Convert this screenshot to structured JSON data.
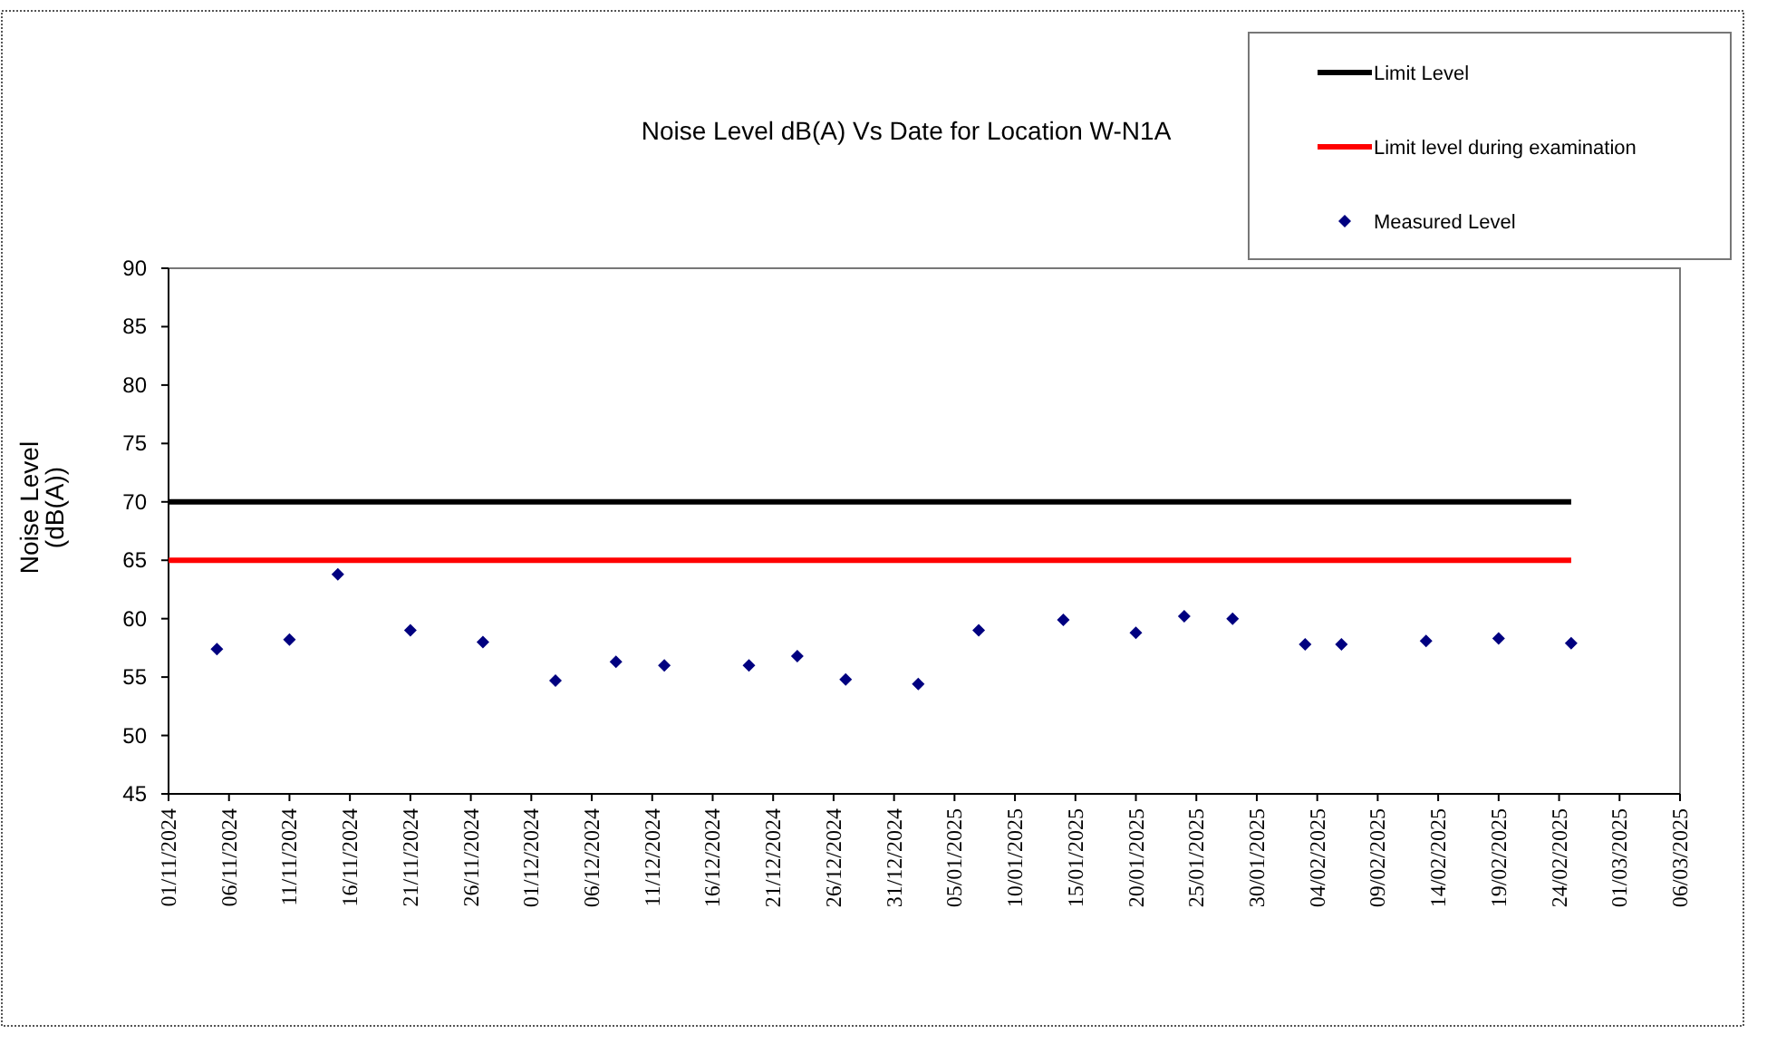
{
  "chart_data": {
    "type": "scatter",
    "title": "Noise Level dB(A) Vs Date for Location W-N1A",
    "ylabel": "Noise Level\n(dB(A))",
    "xlim": [
      "2024-11-01",
      "2025-03-06"
    ],
    "ylim": [
      45,
      90
    ],
    "legend": true,
    "yticks": [
      45,
      50,
      55,
      60,
      65,
      70,
      75,
      80,
      85,
      90
    ],
    "xticks": [
      {
        "value": "2024-11-01",
        "label": "01/11/2024"
      },
      {
        "value": "2024-11-06",
        "label": "06/11/2024"
      },
      {
        "value": "2024-11-11",
        "label": "11/11/2024"
      },
      {
        "value": "2024-11-16",
        "label": "16/11/2024"
      },
      {
        "value": "2024-11-21",
        "label": "21/11/2024"
      },
      {
        "value": "2024-11-26",
        "label": "26/11/2024"
      },
      {
        "value": "2024-12-01",
        "label": "01/12/2024"
      },
      {
        "value": "2024-12-06",
        "label": "06/12/2024"
      },
      {
        "value": "2024-12-11",
        "label": "11/12/2024"
      },
      {
        "value": "2024-12-16",
        "label": "16/12/2024"
      },
      {
        "value": "2024-12-21",
        "label": "21/12/2024"
      },
      {
        "value": "2024-12-26",
        "label": "26/12/2024"
      },
      {
        "value": "2024-12-31",
        "label": "31/12/2024"
      },
      {
        "value": "2025-01-05",
        "label": "05/01/2025"
      },
      {
        "value": "2025-01-10",
        "label": "10/01/2025"
      },
      {
        "value": "2025-01-15",
        "label": "15/01/2025"
      },
      {
        "value": "2025-01-20",
        "label": "20/01/2025"
      },
      {
        "value": "2025-01-25",
        "label": "25/01/2025"
      },
      {
        "value": "2025-01-30",
        "label": "30/01/2025"
      },
      {
        "value": "2025-02-04",
        "label": "04/02/2025"
      },
      {
        "value": "2025-02-09",
        "label": "09/02/2025"
      },
      {
        "value": "2025-02-14",
        "label": "14/02/2025"
      },
      {
        "value": "2025-02-19",
        "label": "19/02/2025"
      },
      {
        "value": "2025-02-24",
        "label": "24/02/2025"
      },
      {
        "value": "2025-03-01",
        "label": "01/03/2025"
      },
      {
        "value": "2025-03-06",
        "label": "06/03/2025"
      }
    ],
    "series": [
      {
        "name": "Limit Level",
        "type": "line",
        "color": "#000000",
        "x": [
          "2024-11-01",
          "2025-02-25"
        ],
        "values": [
          70,
          70
        ]
      },
      {
        "name": "Limit level during examination",
        "type": "line",
        "color": "#ff0000",
        "x": [
          "2024-11-01",
          "2025-02-25"
        ],
        "values": [
          65,
          65
        ]
      },
      {
        "name": "Measured Level",
        "color": "#000080",
        "x": [
          "2024-11-05",
          "2024-11-11",
          "2024-11-15",
          "2024-11-21",
          "2024-11-27",
          "2024-12-03",
          "2024-12-08",
          "2024-12-12",
          "2024-12-19",
          "2024-12-23",
          "2024-12-27",
          "2025-01-02",
          "2025-01-07",
          "2025-01-14",
          "2025-01-20",
          "2025-01-24",
          "2025-01-28",
          "2025-02-03",
          "2025-02-06",
          "2025-02-13",
          "2025-02-19",
          "2025-02-25"
        ],
        "values": [
          57.4,
          58.2,
          63.8,
          59.0,
          58.0,
          54.7,
          56.3,
          56.0,
          56.0,
          56.8,
          54.8,
          54.4,
          59.0,
          59.9,
          58.8,
          60.2,
          60.0,
          57.8,
          57.8,
          58.1,
          58.3,
          57.9
        ]
      }
    ]
  }
}
